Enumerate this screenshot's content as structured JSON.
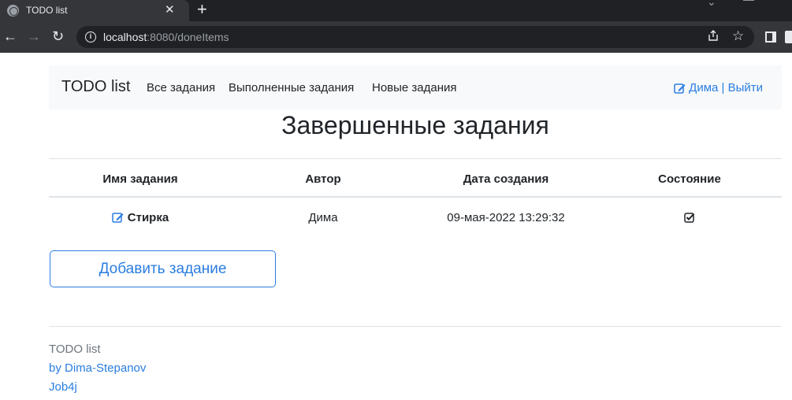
{
  "browser": {
    "tab_title": "TODO list",
    "tab_close": "✕",
    "new_tab": "+",
    "url_host": "localhost",
    "url_rest": ":8080/doneItems",
    "back": "←",
    "forward": "→",
    "reload": "↻"
  },
  "navbar": {
    "brand": "TODO list",
    "links": [
      "Все задания",
      "Выполненные задания",
      "Новые задания"
    ],
    "user": "Дима | Выйти"
  },
  "page": {
    "title": "Завершенные задания"
  },
  "table": {
    "headers": [
      "Имя задания",
      "Автор",
      "Дата создания",
      "Состояние"
    ],
    "rows": [
      {
        "name": "Стирка",
        "author": "Дима",
        "created": "09-мая-2022 13:29:32",
        "done": true
      }
    ]
  },
  "actions": {
    "add_label": "Добавить задание"
  },
  "footer": {
    "line1": "TODO list",
    "line2": "by Dima-Stepanov",
    "line3": "Job4j"
  },
  "colors": {
    "accent": "#2a7de1",
    "chrome_dark": "#202124",
    "chrome_mid": "#35363a"
  }
}
